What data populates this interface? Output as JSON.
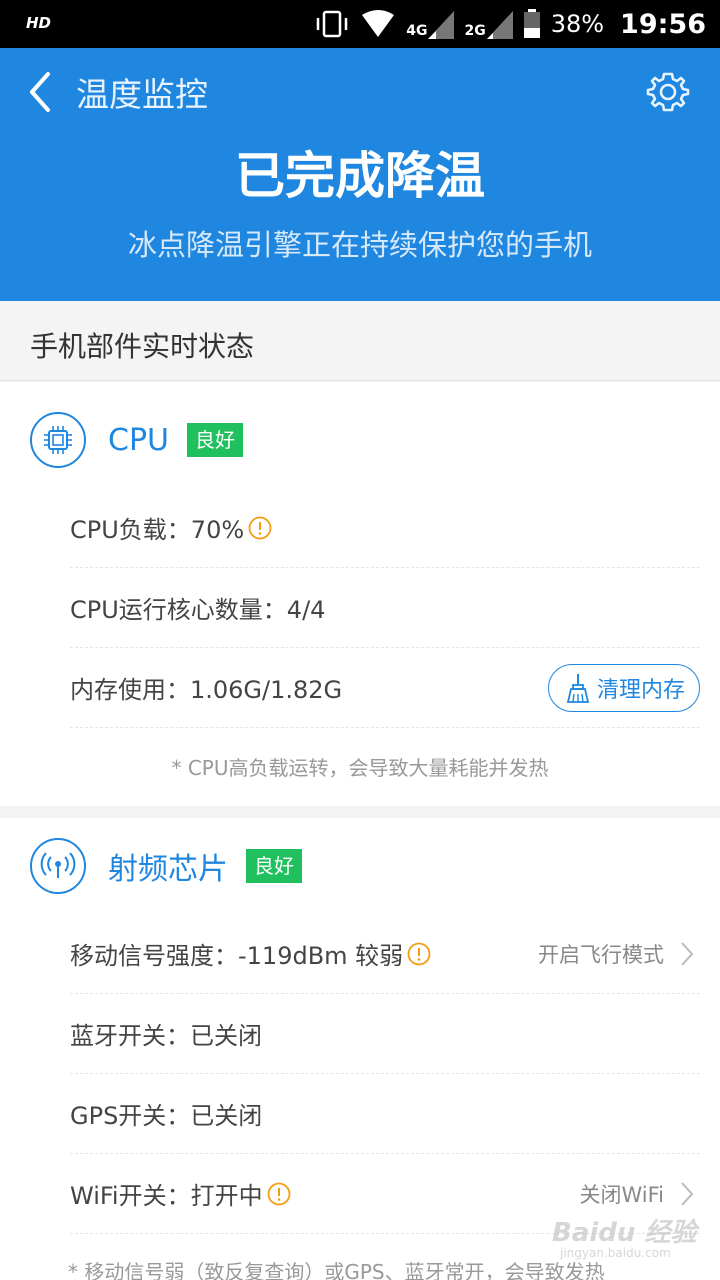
{
  "status_bar": {
    "hd": "HD",
    "net1": "4G",
    "net2": "2G",
    "battery": "38%",
    "time": "19:56"
  },
  "header": {
    "title": "温度监控",
    "headline": "已完成降温",
    "subtitle": "冰点降温引擎正在持续保护您的手机",
    "color": "#1f87e0"
  },
  "section_title": "手机部件实时状态",
  "cpu_card": {
    "name": "CPU",
    "badge": "良好",
    "rows": [
      {
        "label": "CPU负载：70%"
      },
      {
        "label": "CPU运行核心数量：4/4"
      },
      {
        "label": "内存使用：1.06G/1.82G"
      }
    ],
    "clean_button": "清理内存",
    "note": "* CPU高负载运转，会导致大量耗能并发热"
  },
  "rf_card": {
    "name": "射频芯片",
    "badge": "良好",
    "rows": [
      {
        "label": "移动信号强度：-119dBm  较弱",
        "action": "开启飞行模式"
      },
      {
        "label": "蓝牙开关：已关闭"
      },
      {
        "label": "GPS开关：已关闭"
      },
      {
        "label": "WiFi开关：打开中",
        "action": "关闭WiFi"
      }
    ],
    "note": "* 移动信号弱（致反复查询）或GPS、蓝牙常开，会导致发热"
  },
  "watermark": {
    "brand": "Baidu 经验",
    "url": "jingyan.baidu.com"
  },
  "colors": {
    "accent": "#1f87e0",
    "good": "#21c05e",
    "warn": "#f39c12"
  }
}
